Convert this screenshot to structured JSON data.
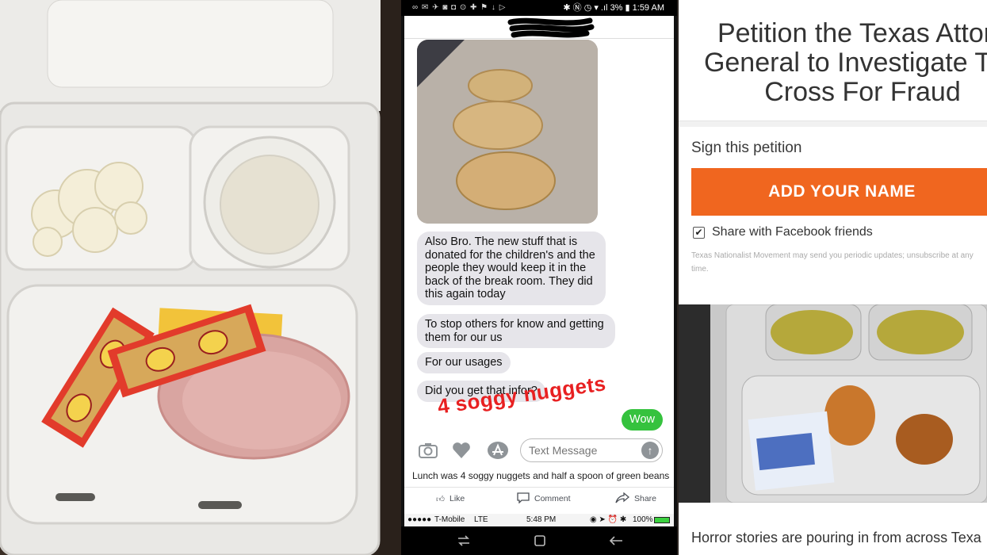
{
  "phone": {
    "status_top": {
      "battery": "3%",
      "time": "1:59 AM"
    },
    "messages": [
      {
        "dir": "in",
        "text": "Also Bro. The new stuff that is donated for the children's and the people they would keep it in the back of the break room. They did this again today"
      },
      {
        "dir": "in",
        "text": "To stop others for know and getting them for our us"
      },
      {
        "dir": "in",
        "text": "For our usages"
      },
      {
        "dir": "in",
        "text": "Did you get that infor?"
      },
      {
        "dir": "out",
        "text": "Wow"
      }
    ],
    "overlay_caption": "4 soggy nuggets",
    "input": {
      "placeholder": "Text Message"
    },
    "fb_caption": "Lunch was 4 soggy nuggets and half a spoon of green beans",
    "fb_actions": {
      "like": "Like",
      "comment": "Comment",
      "share": "Share"
    },
    "status_bottom": {
      "carrier": "T-Mobile",
      "network": "LTE",
      "time": "5:48 PM",
      "battery": "100%"
    }
  },
  "petition": {
    "title_lines": [
      "Petition the Texas Attorn",
      "General to Investigate The",
      "Cross For Fraud"
    ],
    "sign_label": "Sign this petition",
    "button": "ADD YOUR NAME",
    "share_label": "Share with Facebook friends",
    "fine_print": "Texas Nationalist Movement may send you periodic updates; unsubscribe at any time.",
    "teaser": "Horror stories are pouring in from across Texa"
  }
}
